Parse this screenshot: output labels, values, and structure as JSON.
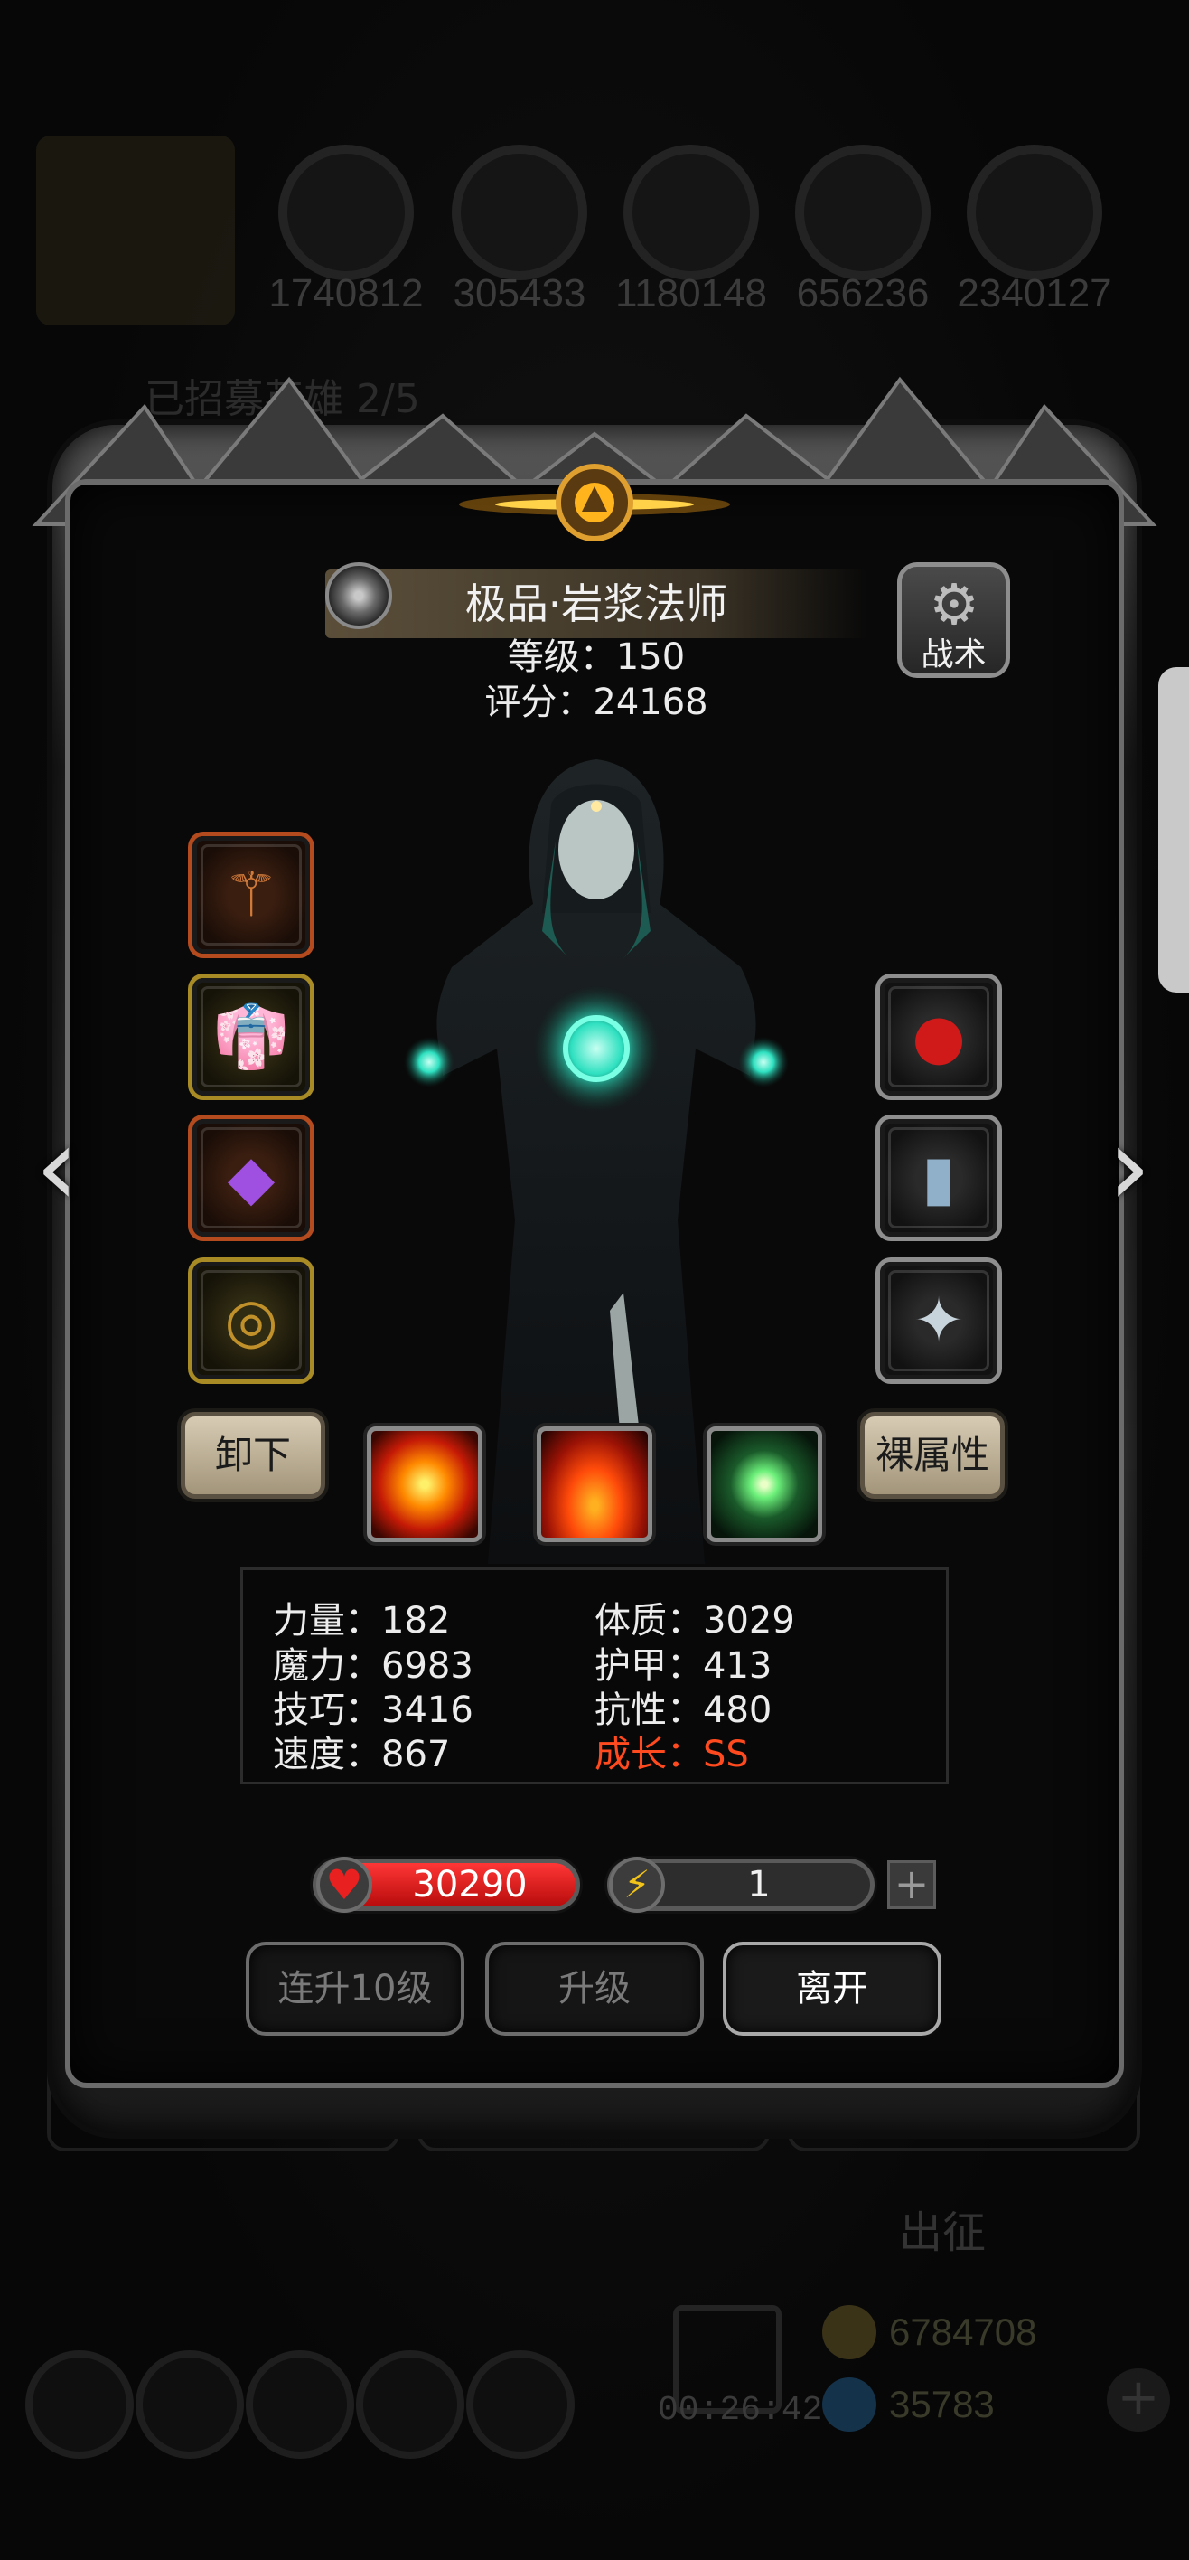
{
  "background": {
    "resources": [
      "1740812",
      "305433",
      "1180148",
      "656236",
      "2340127"
    ],
    "faded_title": "已招募英雄 2/5",
    "expedition_label": "出征",
    "coins": [
      "6784708",
      "35783"
    ],
    "timer": "00:26:42",
    "bottom_buttons": [
      "",
      "",
      ""
    ]
  },
  "hero": {
    "title": "极品·岩浆法师",
    "level_text": "等级：150",
    "score_text": "评分：24168",
    "tactics_label": "战术"
  },
  "equipment": {
    "left": [
      {
        "name": "staff",
        "icon": "staff-icon",
        "rarity": "orange"
      },
      {
        "name": "robe",
        "icon": "robe-icon",
        "rarity": "yellow"
      },
      {
        "name": "amulet",
        "icon": "amulet-icon",
        "rarity": "orange"
      },
      {
        "name": "ring",
        "icon": "ring-icon",
        "rarity": "yellow"
      }
    ],
    "right": [
      {
        "name": "relic",
        "icon": "red-orb-icon",
        "rarity": "grey"
      },
      {
        "name": "book",
        "icon": "book-icon",
        "rarity": "grey"
      },
      {
        "name": "gem",
        "icon": "crystal-icon",
        "rarity": "grey"
      }
    ]
  },
  "actions": {
    "unequip_label": "卸下",
    "base_attr_label": "裸属性"
  },
  "skills": [
    "fire-burst-skill",
    "flame-skill",
    "green-light-skill"
  ],
  "stats": {
    "strength": "力量：182",
    "constitution": "体质：3029",
    "magic": "魔力：6983",
    "armor": "护甲：413",
    "skill": "技巧：3416",
    "resistance": "抗性：480",
    "speed": "速度：867",
    "growth": "成长：SS"
  },
  "bars": {
    "hp": "30290",
    "energy": "1",
    "plus": "+"
  },
  "buttons": {
    "upgrade10": "连升10级",
    "upgrade": "升级",
    "leave": "离开"
  },
  "colors": {
    "growth": "#ff4a1f",
    "hp_bar": "#e11a1a",
    "energy_bolt": "#f2c318",
    "frame": "#6b6b6b"
  }
}
